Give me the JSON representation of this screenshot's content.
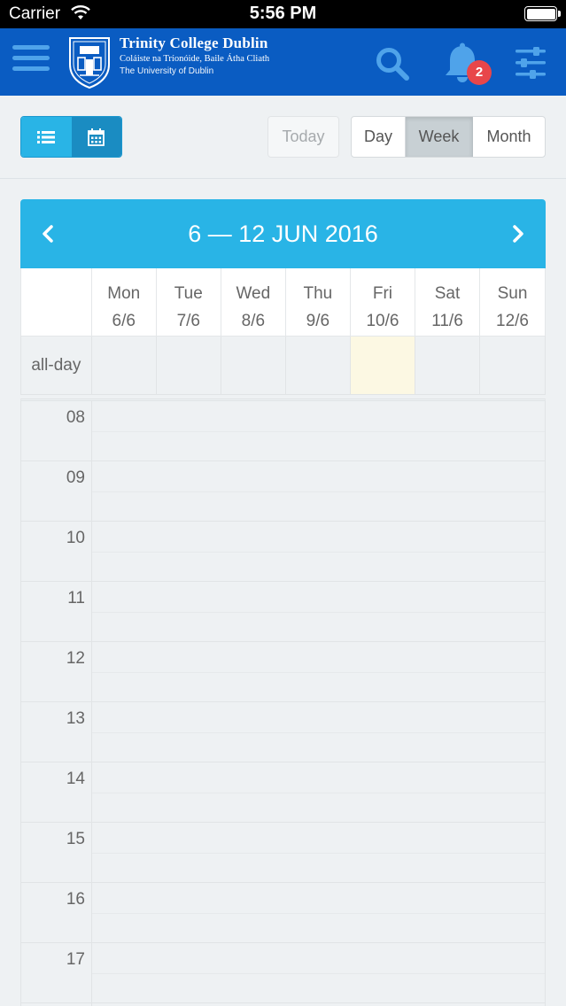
{
  "status_bar": {
    "carrier": "Carrier",
    "time": "5:56 PM"
  },
  "header": {
    "brand_name": "Trinity College Dublin",
    "brand_irish": "Coláiste na Tríonóide, Baile Átha Cliath",
    "brand_university": "The University of Dublin",
    "notification_count": "2",
    "colors": {
      "header_bg": "#0a5cc2",
      "icon": "#4fa3ea",
      "badge": "#e8464a"
    }
  },
  "toolbar": {
    "view_toggle": {
      "list_icon": "list-icon",
      "calendar_icon": "calendar-icon",
      "selected": "calendar"
    },
    "today_label": "Today",
    "range_buttons": [
      "Day",
      "Week",
      "Month"
    ],
    "selected_range": "Week"
  },
  "calendar": {
    "range_title": "6 — 12 JUN 2016",
    "days": [
      {
        "name": "Mon",
        "date": "6/6"
      },
      {
        "name": "Tue",
        "date": "7/6"
      },
      {
        "name": "Wed",
        "date": "8/6"
      },
      {
        "name": "Thu",
        "date": "9/6"
      },
      {
        "name": "Fri",
        "date": "10/6"
      },
      {
        "name": "Sat",
        "date": "11/6"
      },
      {
        "name": "Sun",
        "date": "12/6"
      }
    ],
    "highlighted_day": "Fri",
    "all_day_label": "all-day",
    "hours": [
      "08",
      "09",
      "10",
      "11",
      "12",
      "13",
      "14",
      "15",
      "16",
      "17"
    ],
    "colors": {
      "header_bg": "#29b4e6",
      "today_bg": "#fcf8e3"
    }
  }
}
